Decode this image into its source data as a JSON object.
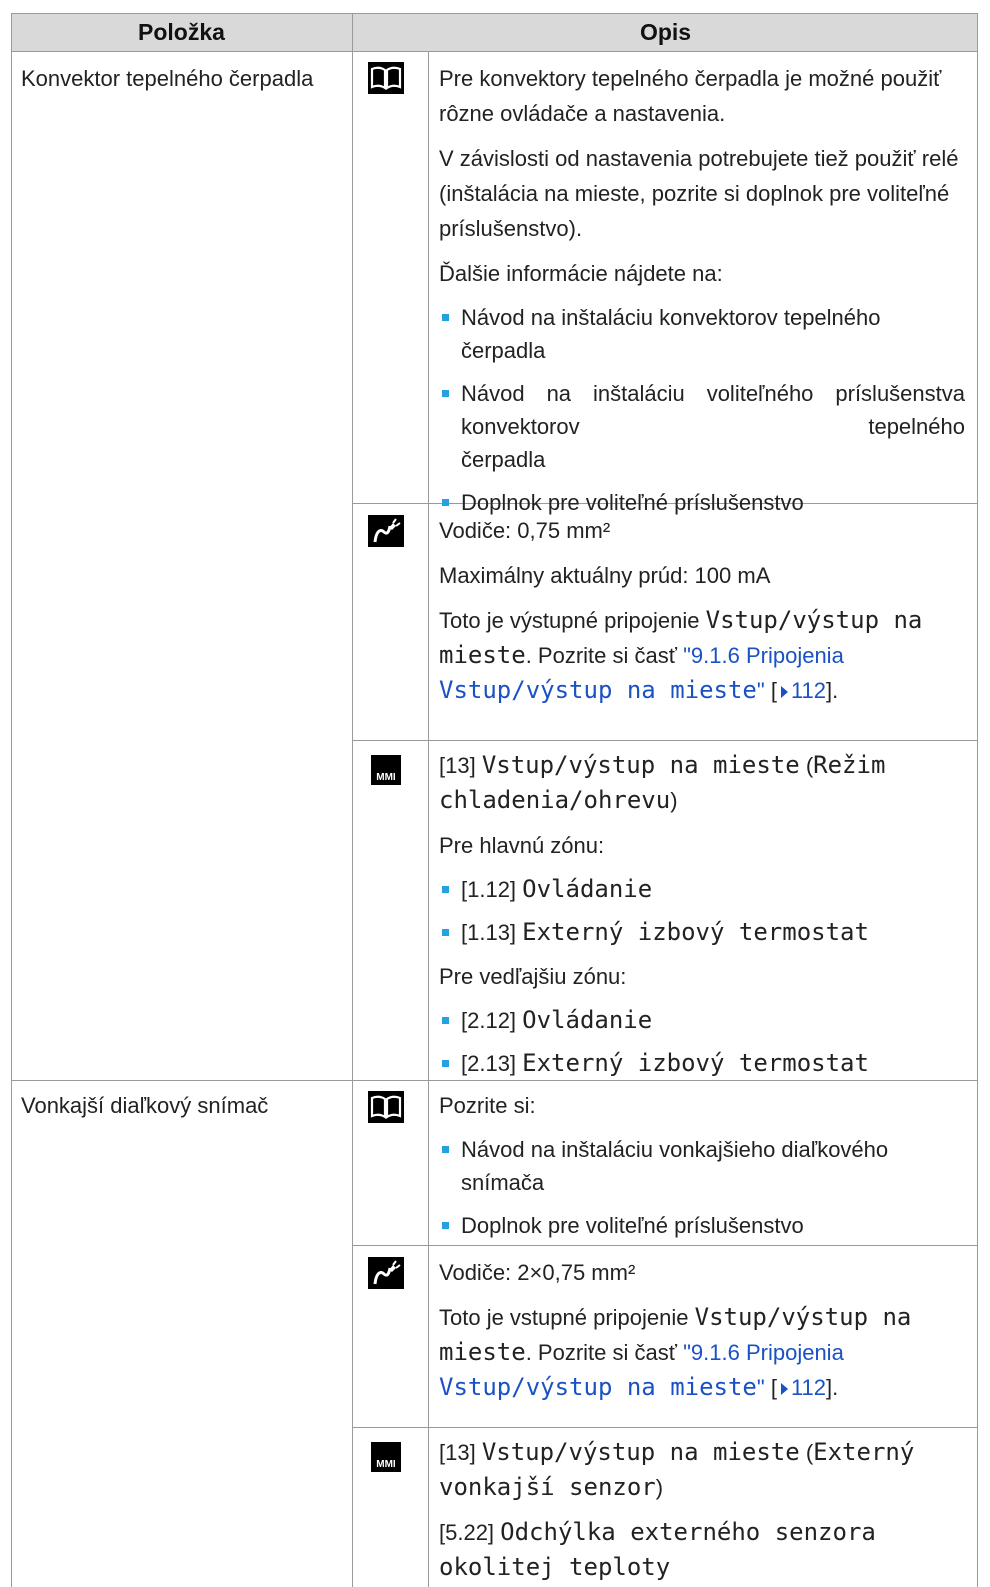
{
  "header": {
    "col_item": "Položka",
    "col_desc": "Opis"
  },
  "icons": {
    "manual": "open-book-icon",
    "wiring": "wiring-plug-icon",
    "mmi": "MMI"
  },
  "rows": [
    {
      "item": "Konvektor tepelného čerpadla",
      "manual": {
        "p1": "Pre konvektory tepelného čerpadla je možné použiť rôzne ovládače a nastavenia.",
        "p2": "V závislosti od nastavenia potrebujete tiež použiť relé (inštalácia na mieste, pozrite si doplnok pre voliteľné príslušenstvo).",
        "p3": "Ďalšie informácie nájdete na:",
        "b1": "Návod na inštaláciu konvektorov tepelného čerpadla",
        "b2_line1": "Návod na inštaláciu voliteľného príslušenstva konvektorov tepelného",
        "b2_line2": "čerpadla",
        "b3": "Doplnok pre voliteľné príslušenstvo"
      },
      "wiring": {
        "p1": "Vodiče: 0,75 mm²",
        "p2": "Maximálny aktuálny prúd: 100 mA",
        "p3_prefix": "Toto je výstupné pripojenie ",
        "p3_code": "Vstup/výstup na mieste",
        "p3_mid": ". Pozrite si časť ",
        "link_text": "\"9.1.6 Pripojenia ",
        "link_code": "Vstup/výstup na mieste",
        "link_end": "\"",
        "page_open": " [",
        "page": "112",
        "page_close": "]."
      },
      "mmi": {
        "l1_num": "[13] ",
        "l1_code": "Vstup/výstup na mieste",
        "l1_open": " (",
        "l1_code2": "Režim chladenia/ohrevu",
        "l1_close": ")",
        "p2": "Pre hlavnú zónu:",
        "b1_num": "[1.12] ",
        "b1_code": "Ovládanie",
        "b2_num": "[1.13] ",
        "b2_code": "Externý izbový termostat",
        "p3": "Pre vedľajšiu zónu:",
        "b3_num": "[2.12] ",
        "b3_code": "Ovládanie",
        "b4_num": "[2.13] ",
        "b4_code": "Externý izbový termostat"
      }
    },
    {
      "item": "Vonkajší diaľkový snímač",
      "manual": {
        "p1": "Pozrite si:",
        "b1": "Návod na inštaláciu vonkajšieho diaľkového snímača",
        "b2": "Doplnok pre voliteľné príslušenstvo"
      },
      "wiring": {
        "p1": "Vodiče: 2×0,75 mm²",
        "p2_prefix": "Toto je vstupné pripojenie ",
        "p2_code": "Vstup/výstup na mieste",
        "p2_mid": ". Pozrite si časť ",
        "link_text": "\"9.1.6 Pripojenia ",
        "link_code": "Vstup/výstup na mieste",
        "link_end": "\"",
        "page_open": " [",
        "page": "112",
        "page_close": "]."
      },
      "mmi": {
        "l1_num": "[13] ",
        "l1_code": "Vstup/výstup na mieste",
        "l1_open": " (",
        "l1_code2": "Externý vonkajší senzor",
        "l1_close": ")",
        "l2_num": "[5.22] ",
        "l2_code": "Odchýlka externého senzora okolitej teploty"
      }
    }
  ]
}
